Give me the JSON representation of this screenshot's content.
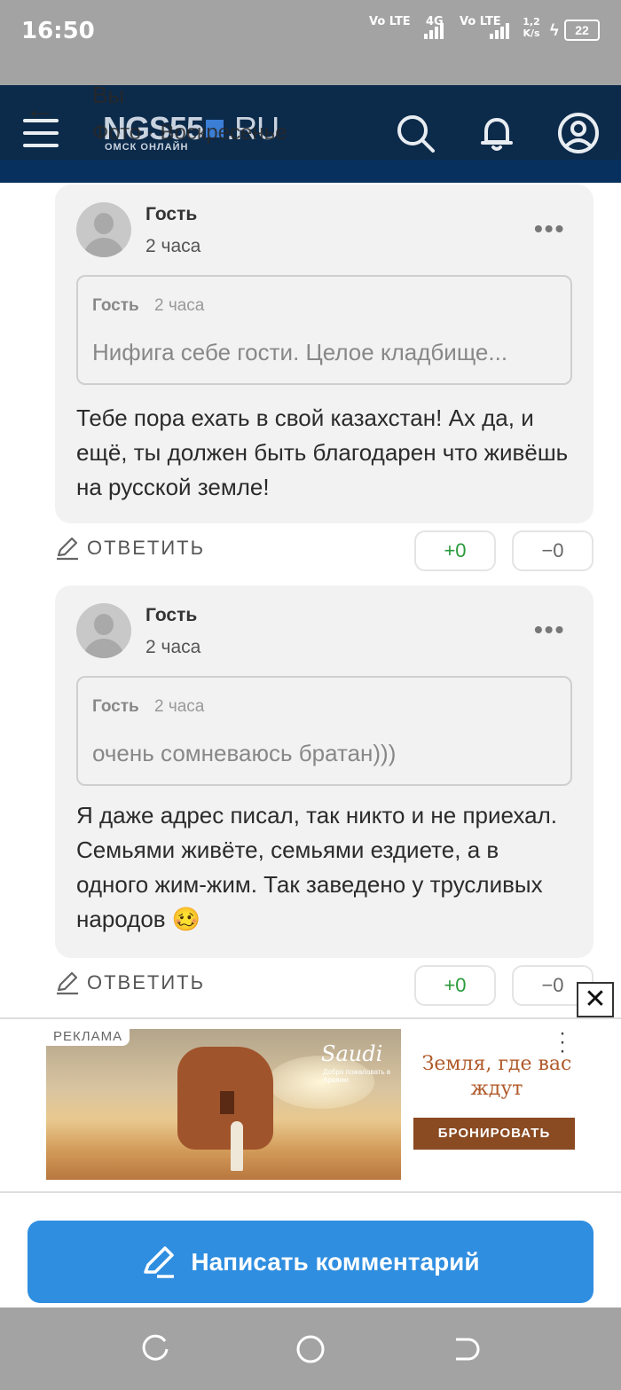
{
  "status_bar": {
    "time": "16:50",
    "network1": "Vo LTE",
    "network2": "4G",
    "network3": "Vo LTE",
    "speed": "1,2 K/s",
    "battery": "22"
  },
  "header": {
    "logo": "NGS55",
    "logo_domain": ".RU",
    "logo_sub": "ОМСК ОНЛАЙН",
    "ghost_title": "Вы",
    "ghost_subtitle": "Фото · Воскресенье"
  },
  "comments": [
    {
      "author": "Гость",
      "ago": "2 часа",
      "quote": {
        "author": "Гость",
        "ago": "2 часа",
        "text": "Нифига себе гости. Целое кладбище..."
      },
      "text": "Тебе пора ехать в свой казахстан! Ах да, и ещё, ты должен быть благодарен что живёшь на русской земле!",
      "reply_label": "ОТВЕТИТЬ",
      "plus": "+0",
      "minus": "−0"
    },
    {
      "author": "Гость",
      "ago": "2 часа",
      "quote": {
        "author": "Гость",
        "ago": "2 часа",
        "text": "очень сомневаюсь братан)))"
      },
      "text": "Я даже адрес писал, так никто и не приехал. Семьями живёте, семьями ездиете, а в одного жим-жим. Так заведено у трусливых народов 🥴",
      "reply_label": "ОТВЕТИТЬ",
      "plus": "+0",
      "minus": "−0"
    }
  ],
  "ad": {
    "label": "РЕКЛАМА",
    "brand": "Saudi",
    "brand_sub": "Добро пожаловать в Аравию",
    "slogan": "Земля, где вас ждут",
    "cta": "БРОНИРОВАТЬ",
    "close": "✕"
  },
  "write_button": {
    "label": "Написать комментарий"
  },
  "colors": {
    "header": "#0c2a4a",
    "accent": "#2f8ee0",
    "plus": "#2a9a3a",
    "ad_cta": "#8a4a22"
  }
}
